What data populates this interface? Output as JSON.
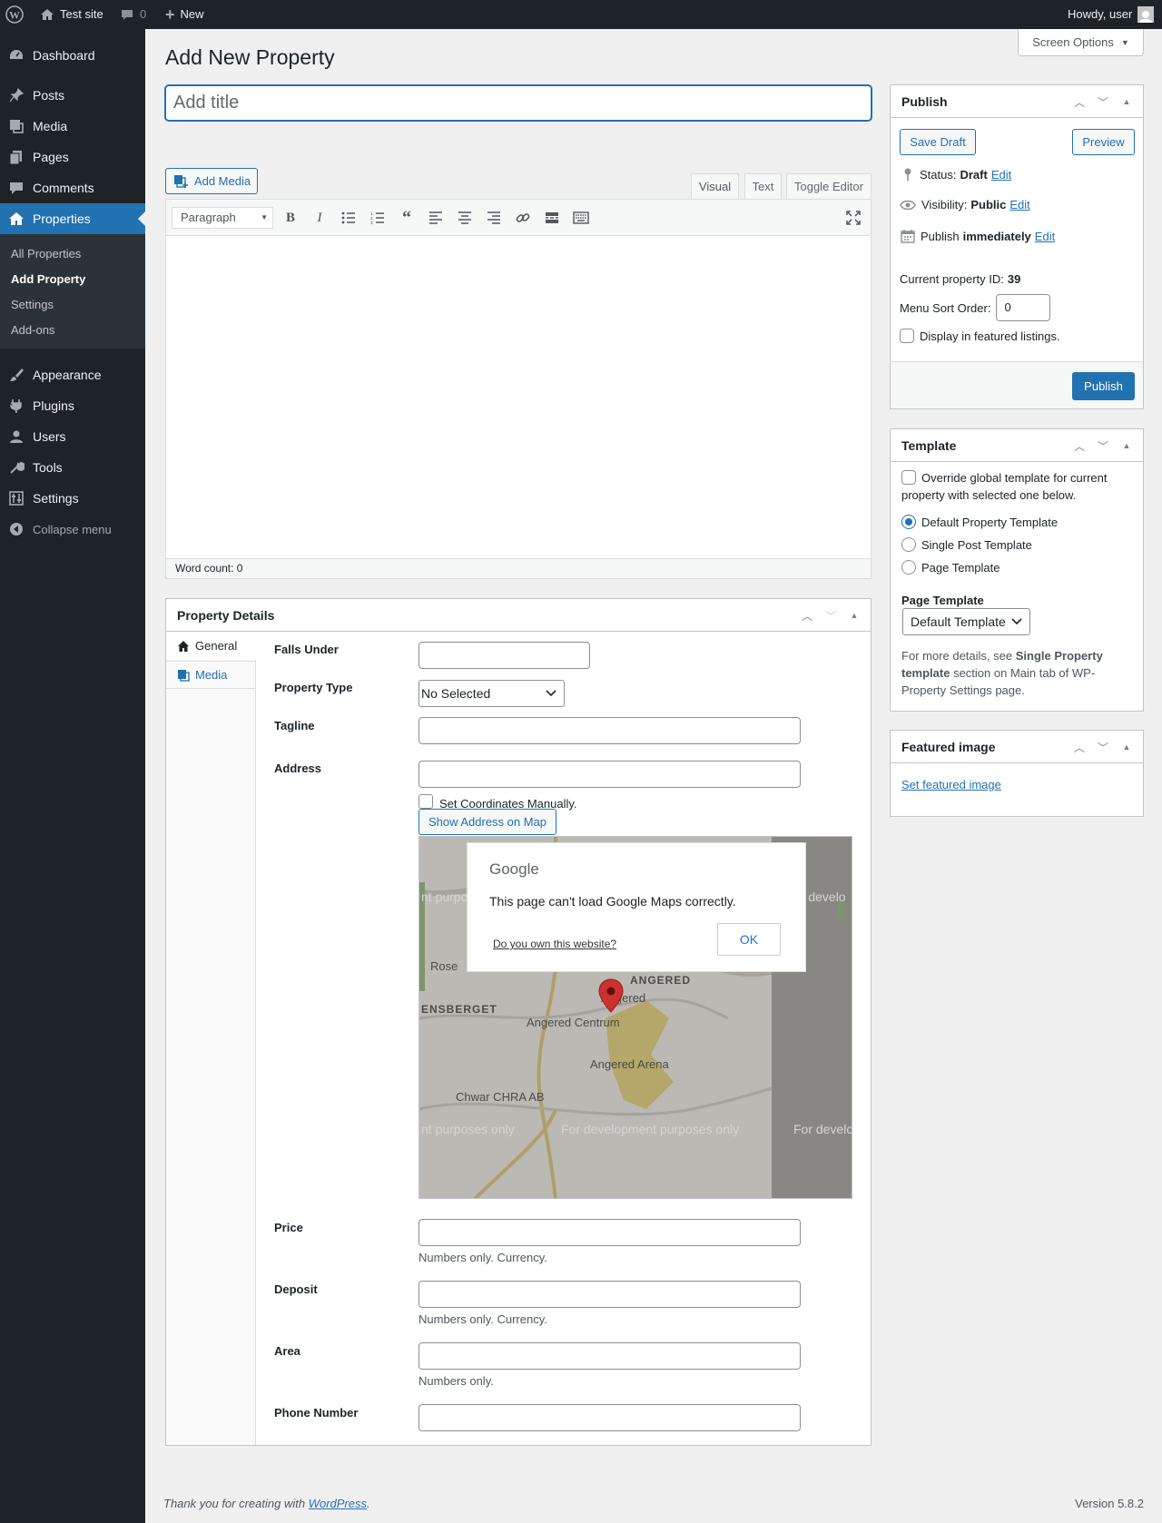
{
  "adminbar": {
    "site_name": "Test site",
    "comments_count": "0",
    "new_label": "New",
    "howdy": "Howdy, user"
  },
  "sidebar": {
    "items": [
      {
        "label": "Dashboard",
        "icon": "dashboard-icon"
      },
      {
        "label": "Posts",
        "icon": "pin-icon"
      },
      {
        "label": "Media",
        "icon": "media-icon"
      },
      {
        "label": "Pages",
        "icon": "pages-icon"
      },
      {
        "label": "Comments",
        "icon": "comment-icon"
      },
      {
        "label": "Properties",
        "icon": "home-icon"
      },
      {
        "label": "Appearance",
        "icon": "brush-icon"
      },
      {
        "label": "Plugins",
        "icon": "plug-icon"
      },
      {
        "label": "Users",
        "icon": "user-icon"
      },
      {
        "label": "Tools",
        "icon": "wrench-icon"
      },
      {
        "label": "Settings",
        "icon": "settings-icon"
      },
      {
        "label": "Collapse menu",
        "icon": "collapse-icon"
      }
    ],
    "submenu": [
      "All Properties",
      "Add Property",
      "Settings",
      "Add-ons"
    ]
  },
  "page": {
    "title": "Add New Property",
    "screen_options": "Screen Options",
    "title_placeholder": "Add title",
    "add_media": "Add Media"
  },
  "editor": {
    "tabs": [
      "Visual",
      "Text",
      "Toggle Editor"
    ],
    "format": "Paragraph",
    "word_count": "Word count: 0"
  },
  "publish": {
    "title": "Publish",
    "save_draft": "Save Draft",
    "preview": "Preview",
    "status_label": "Status:",
    "status_value": "Draft",
    "visibility_label": "Visibility:",
    "visibility_value": "Public",
    "publish_label": "Publish",
    "publish_value": "immediately",
    "edit": "Edit",
    "property_id_label": "Current property ID:",
    "property_id": "39",
    "sort_label": "Menu Sort Order:",
    "sort_value": "0",
    "featured_label": "Display in featured listings.",
    "publish_button": "Publish"
  },
  "template": {
    "title": "Template",
    "override_label": "Override global template for current property with selected one below.",
    "options": [
      "Default Property Template",
      "Single Post Template",
      "Page Template"
    ],
    "selected": "Default Property Template",
    "page_template_label": "Page Template",
    "page_template_value": "Default Template",
    "note_prefix": "For more details, see ",
    "note_bold": "Single Property template",
    "note_suffix": " section on Main tab of WP-Property Settings page."
  },
  "featured": {
    "title": "Featured image",
    "link": "Set featured image"
  },
  "details": {
    "title": "Property Details",
    "tabs": [
      "General",
      "Media"
    ],
    "falls_under": "Falls Under",
    "property_type": "Property Type",
    "property_type_value": "No Selected",
    "tagline": "Tagline",
    "address": "Address",
    "set_coords": "Set Coordinates Manually.",
    "show_map": "Show Address on Map",
    "price": "Price",
    "deposit": "Deposit",
    "area": "Area",
    "phone": "Phone Number",
    "currency_note": "Numbers only. Currency.",
    "numbers_note": "Numbers only."
  },
  "map": {
    "google": "Google",
    "error": "This page can't load Google Maps correctly.",
    "own_site": "Do you own this website?",
    "ok": "OK",
    "dev_text": "For development purposes only",
    "dev_text_left": "nt purposes only",
    "dev_text_right": "For develo",
    "dev_text_top_left": "nt purpo",
    "dev_text_top_right": "or develo",
    "place_rose": "Rose",
    "place_ensberget": "ENSBERGET",
    "place_angered_caps": "ANGERED",
    "place_angered": "Angered",
    "place_centrum": "Angered Centrum",
    "place_arena": "Angered Arena",
    "place_chwar": "Chwar CHRA AB"
  },
  "footer": {
    "thanks": "Thank you for creating with ",
    "wp": "WordPress",
    "version": "Version 5.8.2"
  }
}
